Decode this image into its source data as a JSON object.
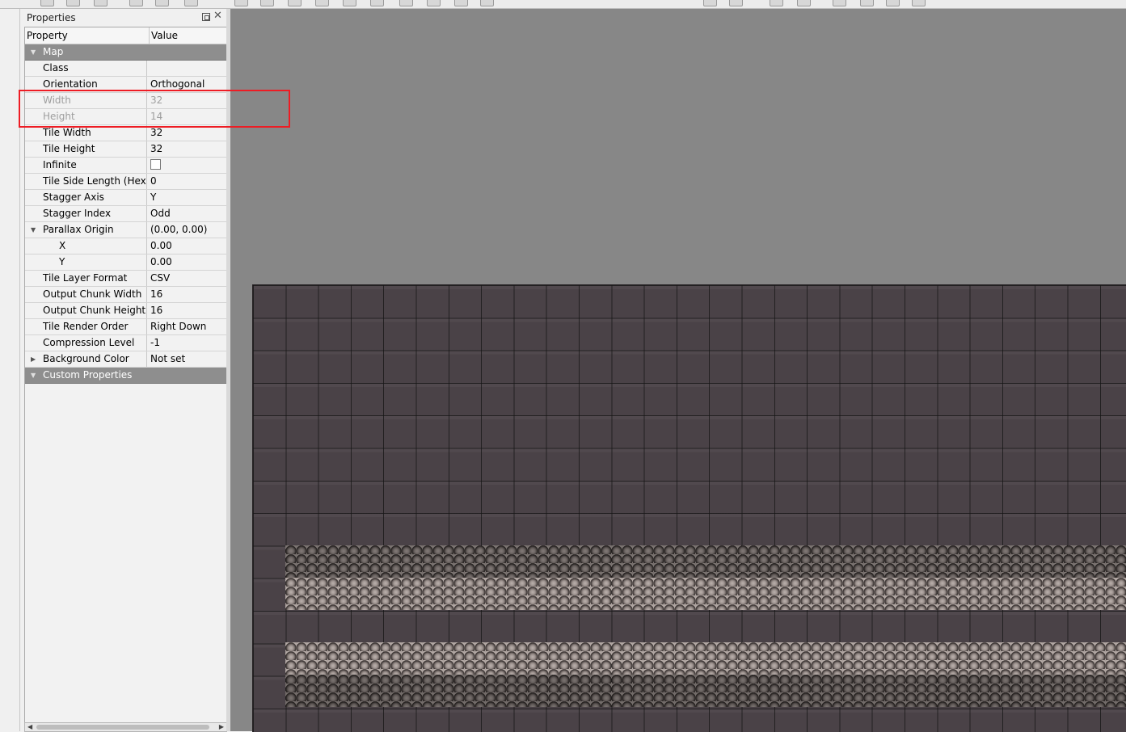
{
  "panel": {
    "title": "Properties",
    "columns": {
      "property": "Property",
      "value": "Value"
    }
  },
  "rows": {
    "map": {
      "label": "Map"
    },
    "class": {
      "label": "Class",
      "value": ""
    },
    "orientation": {
      "label": "Orientation",
      "value": "Orthogonal"
    },
    "width": {
      "label": "Width",
      "value": "32"
    },
    "height": {
      "label": "Height",
      "value": "14"
    },
    "tile_width": {
      "label": "Tile Width",
      "value": "32"
    },
    "tile_height": {
      "label": "Tile Height",
      "value": "32"
    },
    "infinite": {
      "label": "Infinite",
      "checked": false
    },
    "tile_side_length": {
      "label": "Tile Side Length (Hex)",
      "value": "0"
    },
    "stagger_axis": {
      "label": "Stagger Axis",
      "value": "Y"
    },
    "stagger_index": {
      "label": "Stagger Index",
      "value": "Odd"
    },
    "parallax_origin": {
      "label": "Parallax Origin",
      "value": "(0.00, 0.00)"
    },
    "parallax_x": {
      "label": "X",
      "value": "0.00"
    },
    "parallax_y": {
      "label": "Y",
      "value": "0.00"
    },
    "tile_layer_format": {
      "label": "Tile Layer Format",
      "value": "CSV"
    },
    "output_chunk_width": {
      "label": "Output Chunk Width",
      "value": "16"
    },
    "output_chunk_height": {
      "label": "Output Chunk Height",
      "value": "16"
    },
    "tile_render_order": {
      "label": "Tile Render Order",
      "value": "Right Down"
    },
    "compression_level": {
      "label": "Compression Level",
      "value": "-1"
    },
    "background_color": {
      "label": "Background Color",
      "value": "Not set"
    },
    "custom_properties": {
      "label": "Custom Properties"
    }
  },
  "icons": {
    "expanded": "▼",
    "collapsed": "▶",
    "close": "✕",
    "scroll_left": "◀",
    "scroll_right": "▶"
  },
  "colors": {
    "group_header": "#8e8e8e",
    "canvas_bg": "#878787",
    "map_bg": "#4a4247",
    "highlight": "#ee1c24"
  }
}
